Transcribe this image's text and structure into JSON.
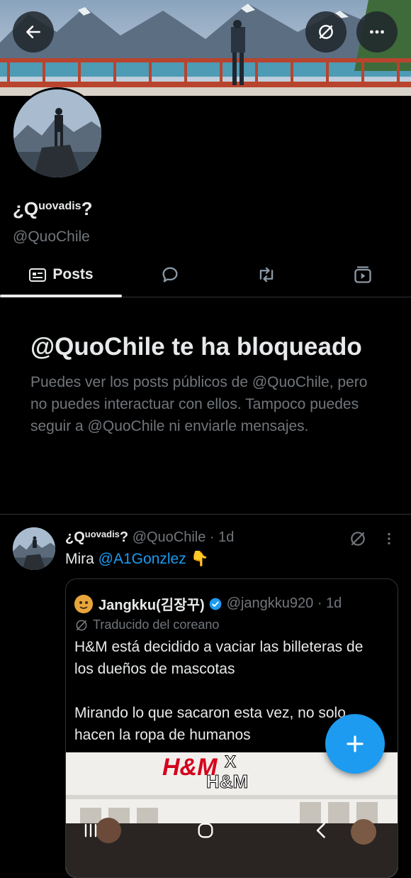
{
  "profile": {
    "name_prefix": "¿Q",
    "name_sup": "uovadis",
    "name_suffix": "?",
    "handle": "@QuoChile"
  },
  "tabs": [
    {
      "label": "Posts",
      "icon": "posts-icon",
      "active": true
    },
    {
      "label": "",
      "icon": "replies-icon",
      "active": false
    },
    {
      "label": "",
      "icon": "reposts-icon",
      "active": false
    },
    {
      "label": "",
      "icon": "media-icon",
      "active": false
    }
  ],
  "blocked": {
    "title": "@QuoChile te ha bloqueado",
    "message": "Puedes ver los posts públicos de @QuoChile, pero no puedes interactuar con ellos. Tampoco puedes seguir a @QuoChile ni enviarle mensajes."
  },
  "post": {
    "name_prefix": "¿Q",
    "name_sup": "uovadis",
    "name_suffix": "?",
    "meta": "@QuoChile · 1d",
    "text_prefix": "Mira ",
    "mention": "@A1Gonzlez",
    "emoji": "👇"
  },
  "quote": {
    "name": "Jangkku(김장꾸)",
    "meta": "@jangkku920 · 1d",
    "translated_label": "Traducido del coreano",
    "body": "H&M está decidido a vaciar las billeteras de los dueños de mascotas\n\nMirando lo que sacaron esta vez, no solo hacen la ropa de humanos",
    "image_text_1": "H&M",
    "image_text_2": "X",
    "image_text_3": "H&M"
  },
  "colors": {
    "accent": "#1d9bf0",
    "background": "#000000",
    "muted": "#71767b",
    "text": "#e7e9ea"
  }
}
